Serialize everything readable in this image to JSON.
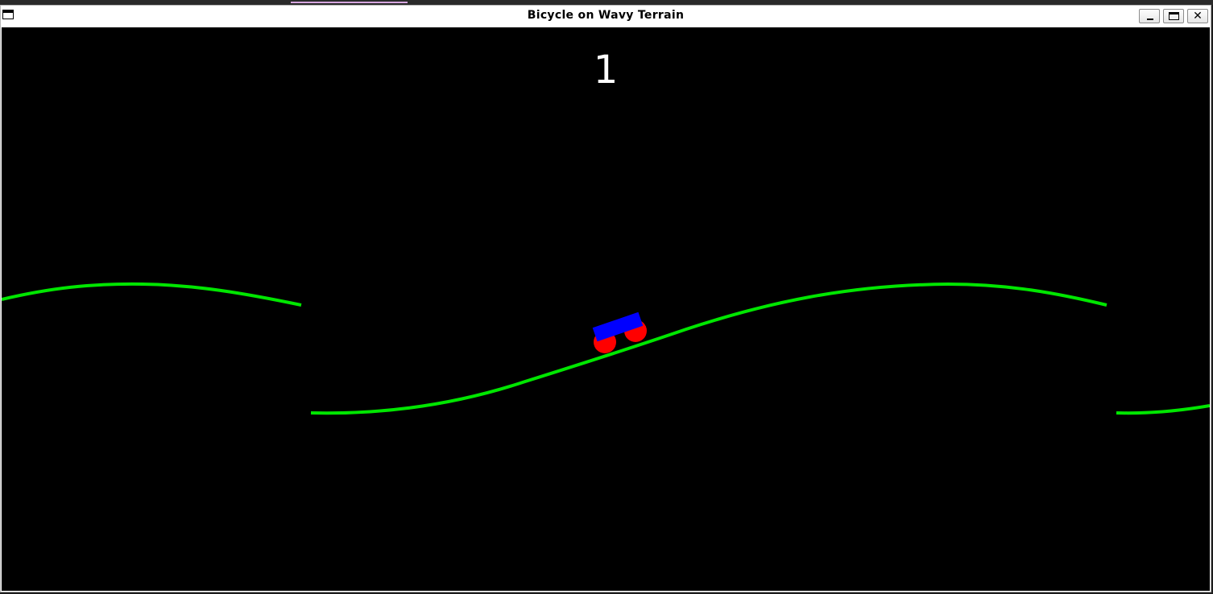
{
  "window": {
    "title": "Bicycle on Wavy Terrain"
  },
  "game": {
    "score": "1",
    "colors": {
      "background": "#000000",
      "terrain": "#00e600",
      "bicycle_frame": "#0000ff",
      "wheels": "#ff0000",
      "score_text": "#ffffff"
    }
  },
  "icons": {
    "app": "window-icon",
    "minimize": "minimize-icon",
    "maximize": "maximize-icon",
    "close": "close-icon"
  }
}
